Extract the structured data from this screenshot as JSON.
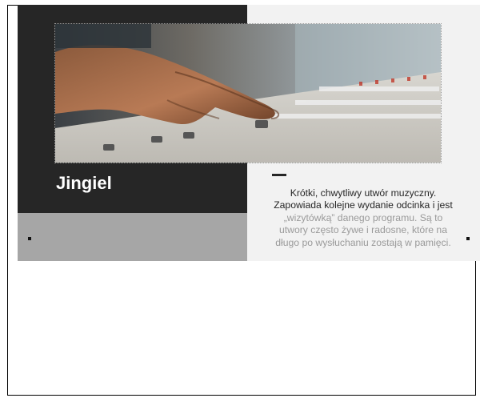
{
  "slide": {
    "title": "Jingiel",
    "description_visible_lines": [
      "Krótki, chwytliwy utwór muzyczny.",
      "Zapowiada kolejne wydanie odcinka i jest"
    ],
    "description_faded_lines": [
      "„wizytówką” danego programu. Są to",
      "utwory często żywe i radosne, które na",
      "długo po wysłuchaniu zostają w pamięci."
    ],
    "photo_icon": "mixing-console-photo",
    "colors": {
      "dark_panel": "#262626",
      "gray_band": "#a6a6a6",
      "light_panel": "#f2f2f2",
      "text_dark": "#262626",
      "text_faded": "#9a9a9a"
    }
  }
}
